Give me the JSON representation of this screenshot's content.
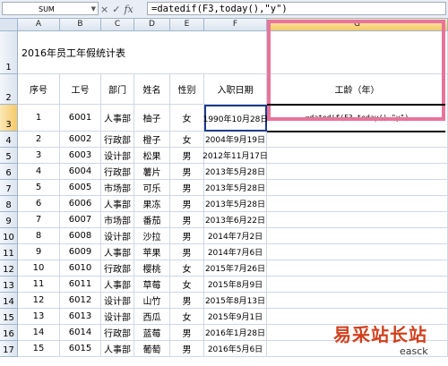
{
  "formula_bar": {
    "name_box": "SUM",
    "cancel_icon": "×",
    "enter_icon": "✓",
    "fx_label": "fx",
    "formula": "=datedif(F3,today(),\"y\")"
  },
  "columns": [
    "A",
    "B",
    "C",
    "D",
    "E",
    "F",
    "G"
  ],
  "sheet": {
    "title": "2016年员工年假统计表",
    "headers": {
      "seq": "序号",
      "emp_no": "工号",
      "dept": "部门",
      "name": "姓名",
      "gender": "性别",
      "hire_date": "入职日期",
      "seniority": "工龄（年）"
    },
    "editing_formula": "=datedif(F3,today(),\"y\")",
    "rows": [
      {
        "row": "3",
        "seq": "1",
        "emp_no": "6001",
        "dept": "人事部",
        "name": "柚子",
        "gender": "女",
        "hire_date": "1990年10月28日"
      },
      {
        "row": "4",
        "seq": "2",
        "emp_no": "6002",
        "dept": "行政部",
        "name": "橙子",
        "gender": "女",
        "hire_date": "2004年9月19日"
      },
      {
        "row": "5",
        "seq": "3",
        "emp_no": "6003",
        "dept": "设计部",
        "name": "松果",
        "gender": "男",
        "hire_date": "2012年11月17日"
      },
      {
        "row": "6",
        "seq": "4",
        "emp_no": "6004",
        "dept": "行政部",
        "name": "薯片",
        "gender": "男",
        "hire_date": "2013年5月28日"
      },
      {
        "row": "7",
        "seq": "5",
        "emp_no": "6005",
        "dept": "市场部",
        "name": "可乐",
        "gender": "男",
        "hire_date": "2013年5月28日"
      },
      {
        "row": "8",
        "seq": "6",
        "emp_no": "6006",
        "dept": "人事部",
        "name": "果冻",
        "gender": "男",
        "hire_date": "2013年5月28日"
      },
      {
        "row": "9",
        "seq": "7",
        "emp_no": "6007",
        "dept": "市场部",
        "name": "番茄",
        "gender": "男",
        "hire_date": "2013年6月22日"
      },
      {
        "row": "10",
        "seq": "8",
        "emp_no": "6008",
        "dept": "设计部",
        "name": "沙拉",
        "gender": "男",
        "hire_date": "2014年7月2日"
      },
      {
        "row": "11",
        "seq": "9",
        "emp_no": "6009",
        "dept": "人事部",
        "name": "苹果",
        "gender": "男",
        "hire_date": "2014年7月6日"
      },
      {
        "row": "12",
        "seq": "10",
        "emp_no": "6010",
        "dept": "行政部",
        "name": "樱桃",
        "gender": "女",
        "hire_date": "2015年7月26日"
      },
      {
        "row": "13",
        "seq": "11",
        "emp_no": "6011",
        "dept": "人事部",
        "name": "草莓",
        "gender": "女",
        "hire_date": "2015年8月9日"
      },
      {
        "row": "14",
        "seq": "12",
        "emp_no": "6012",
        "dept": "设计部",
        "name": "山竹",
        "gender": "男",
        "hire_date": "2015年8月13日"
      },
      {
        "row": "15",
        "seq": "13",
        "emp_no": "6013",
        "dept": "设计部",
        "name": "西瓜",
        "gender": "女",
        "hire_date": "2015年9月1日"
      },
      {
        "row": "16",
        "seq": "14",
        "emp_no": "6014",
        "dept": "行政部",
        "name": "蓝莓",
        "gender": "男",
        "hire_date": "2016年1月28日"
      },
      {
        "row": "17",
        "seq": "15",
        "emp_no": "6015",
        "dept": "人事部",
        "name": "葡萄",
        "gender": "男",
        "hire_date": "2016年5月6日"
      }
    ]
  },
  "watermark": {
    "brand": "易采站长站",
    "domain": "easck"
  },
  "colors": {
    "highlight_border": "#e8739b",
    "active_cell_border": "#1e3a8a"
  }
}
